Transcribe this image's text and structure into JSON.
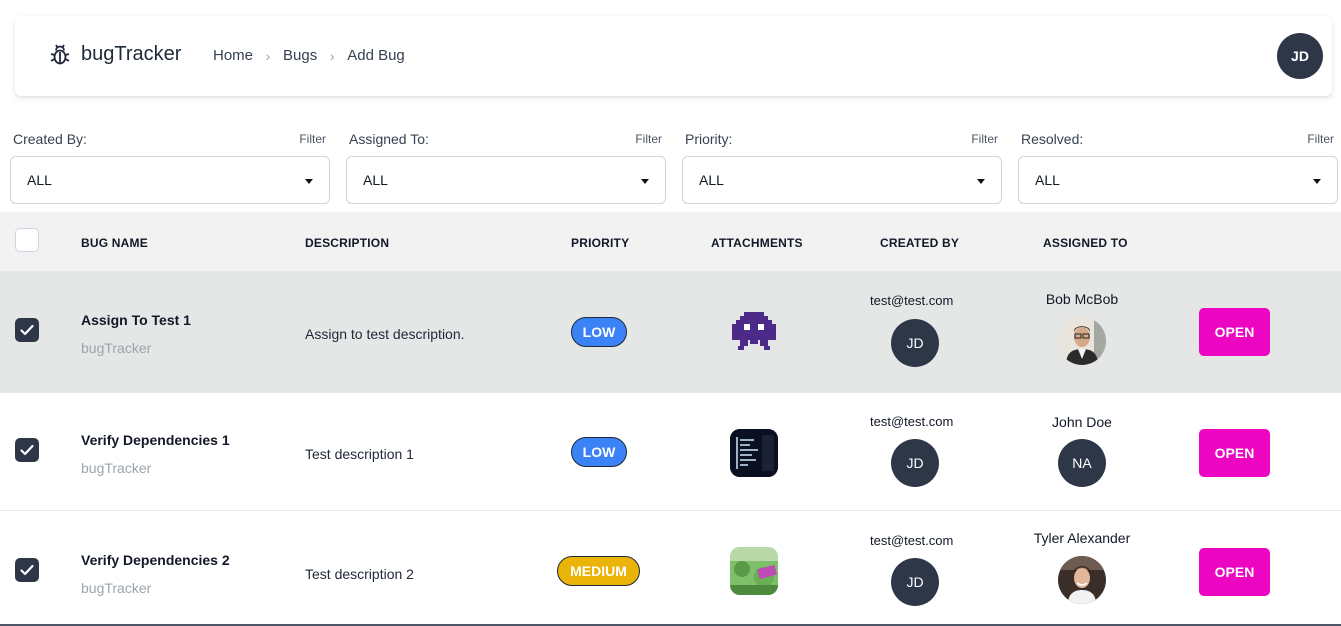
{
  "header": {
    "app_name": "bugTracker",
    "app_icon": "bug-icon",
    "breadcrumbs": [
      "Home",
      "Bugs",
      "Add Bug"
    ],
    "user_initials": "JD"
  },
  "filters": [
    {
      "label": "Created By:",
      "action": "Filter",
      "value": "ALL"
    },
    {
      "label": "Assigned To:",
      "action": "Filter",
      "value": "ALL"
    },
    {
      "label": "Priority:",
      "action": "Filter",
      "value": "ALL"
    },
    {
      "label": "Resolved:",
      "action": "Filter",
      "value": "ALL"
    }
  ],
  "table": {
    "columns": [
      "BUG NAME",
      "DESCRIPTION",
      "PRIORITY",
      "ATTACHMENTS",
      "CREATED BY",
      "ASSIGNED TO"
    ],
    "rows": [
      {
        "name": "Assign To Test 1",
        "project": "bugTracker",
        "description": "Assign to test description.",
        "priority": "LOW",
        "attachment": "pixel-invader-image",
        "created_by_email": "test@test.com",
        "created_by_initials": "JD",
        "assignee_name": "Bob McBob",
        "assignee_avatar": "photo",
        "action": "OPEN",
        "checked": true,
        "highlighted": true
      },
      {
        "name": "Verify Dependencies 1",
        "project": "bugTracker",
        "description": "Test description 1",
        "priority": "LOW",
        "attachment": "terminal-screenshot-image",
        "created_by_email": "test@test.com",
        "created_by_initials": "JD",
        "assignee_name": "John Doe",
        "assignee_initials": "NA",
        "action": "OPEN",
        "checked": true,
        "highlighted": false
      },
      {
        "name": "Verify Dependencies 2",
        "project": "bugTracker",
        "description": "Test description 2",
        "priority": "MEDIUM",
        "attachment": "landscape-sticker-image",
        "created_by_email": "test@test.com",
        "created_by_initials": "JD",
        "assignee_name": "Tyler Alexander",
        "assignee_avatar": "photo",
        "action": "OPEN",
        "checked": true,
        "highlighted": false
      }
    ]
  },
  "colors": {
    "open_button": "#ec06c1",
    "low": "#3b82f6",
    "medium": "#eab308",
    "avatar": "#2d3748"
  }
}
